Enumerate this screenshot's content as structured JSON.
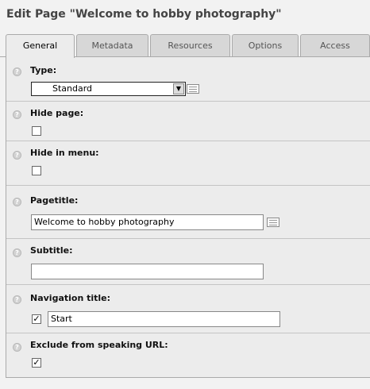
{
  "page": {
    "title": "Edit Page \"Welcome to hobby photography\""
  },
  "tabs": [
    {
      "label": "General",
      "active": true
    },
    {
      "label": "Metadata",
      "active": false
    },
    {
      "label": "Resources",
      "active": false
    },
    {
      "label": "Options",
      "active": false
    },
    {
      "label": "Access",
      "active": false
    }
  ],
  "form": {
    "type": {
      "label": "Type:",
      "value": "Standard"
    },
    "hide_page": {
      "label": "Hide page:",
      "checked": false
    },
    "hide_in_menu": {
      "label": "Hide in menu:",
      "checked": false
    },
    "pagetitle": {
      "label": "Pagetitle:",
      "value": "Welcome to hobby photography"
    },
    "subtitle": {
      "label": "Subtitle:",
      "value": ""
    },
    "navigation_title": {
      "label": "Navigation title:",
      "checked": true,
      "checkmark": "✓",
      "value": "Start"
    },
    "exclude_speaking_url": {
      "label": "Exclude from speaking URL:",
      "checked": true,
      "checkmark": "✓"
    }
  },
  "icons": {
    "help": "help-icon",
    "wizard": "list-wizard-icon",
    "dropdown": "chevron-down-icon"
  }
}
